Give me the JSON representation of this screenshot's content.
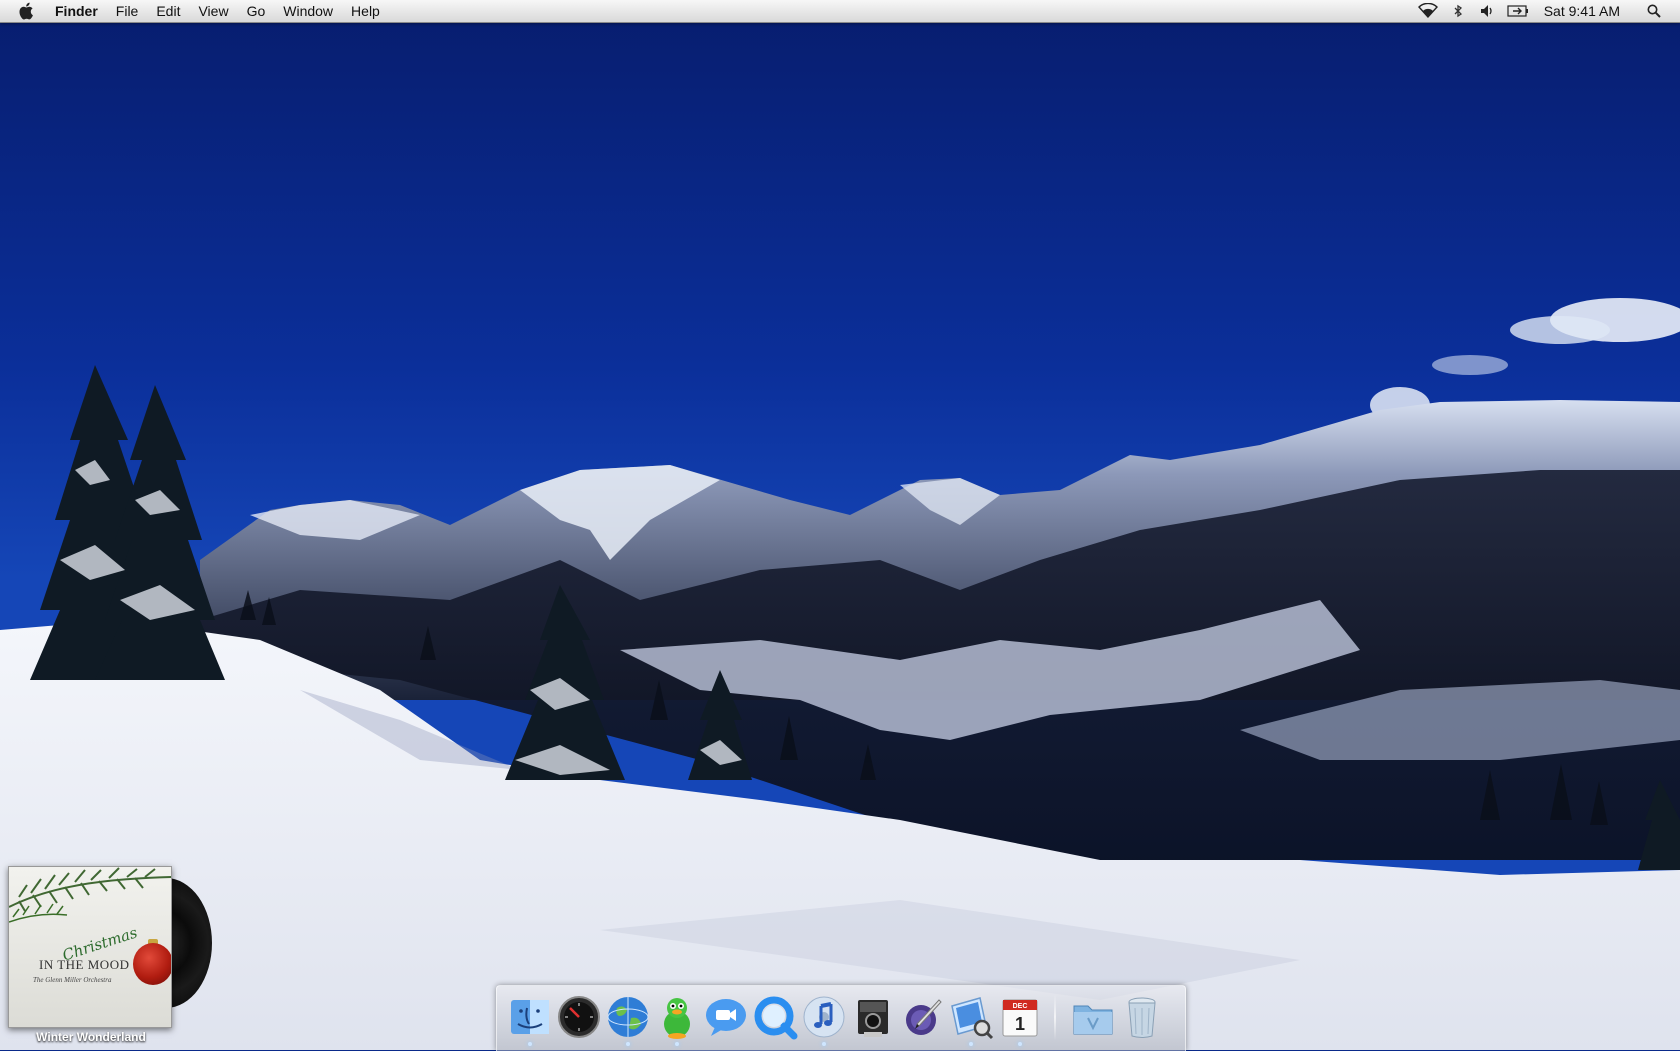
{
  "menubar": {
    "apple_icon": "apple-icon",
    "app_name": "Finder",
    "menus": [
      "File",
      "Edit",
      "View",
      "Go",
      "Window",
      "Help"
    ],
    "status_icons": [
      "wifi-icon",
      "bluetooth-icon",
      "volume-icon",
      "battery-icon"
    ],
    "clock": "Sat 9:41 AM",
    "spotlight_icon": "search-icon"
  },
  "album_widget": {
    "cover_script": "Christmas",
    "cover_title": "IN THE MOOD",
    "cover_subtitle": "The Glenn Miller Orchestra",
    "caption": "Winter Wonderland"
  },
  "dock": {
    "apps": [
      {
        "name": "Finder",
        "icon": "finder-icon",
        "running": true
      },
      {
        "name": "Dashboard",
        "icon": "dashboard-icon",
        "running": false
      },
      {
        "name": "Safari",
        "icon": "safari-globe-icon",
        "running": true
      },
      {
        "name": "Adium",
        "icon": "adium-duck-icon",
        "running": true
      },
      {
        "name": "iChat",
        "icon": "ichat-icon",
        "running": false
      },
      {
        "name": "QuickTime",
        "icon": "quicktime-icon",
        "running": false
      },
      {
        "name": "iTunes",
        "icon": "itunes-icon",
        "running": true
      },
      {
        "name": "Photo Booth",
        "icon": "photo-booth-icon",
        "running": false
      },
      {
        "name": "Script Editor",
        "icon": "script-pen-icon",
        "running": false
      },
      {
        "name": "Preview",
        "icon": "preview-icon",
        "running": true
      },
      {
        "name": "iCal",
        "icon": "calendar-icon",
        "running": true
      }
    ],
    "calendar_month": "DEC",
    "calendar_day": "1",
    "stacks": [
      {
        "name": "Applications",
        "icon": "folder-icon"
      },
      {
        "name": "Trash",
        "icon": "trash-icon"
      }
    ]
  }
}
